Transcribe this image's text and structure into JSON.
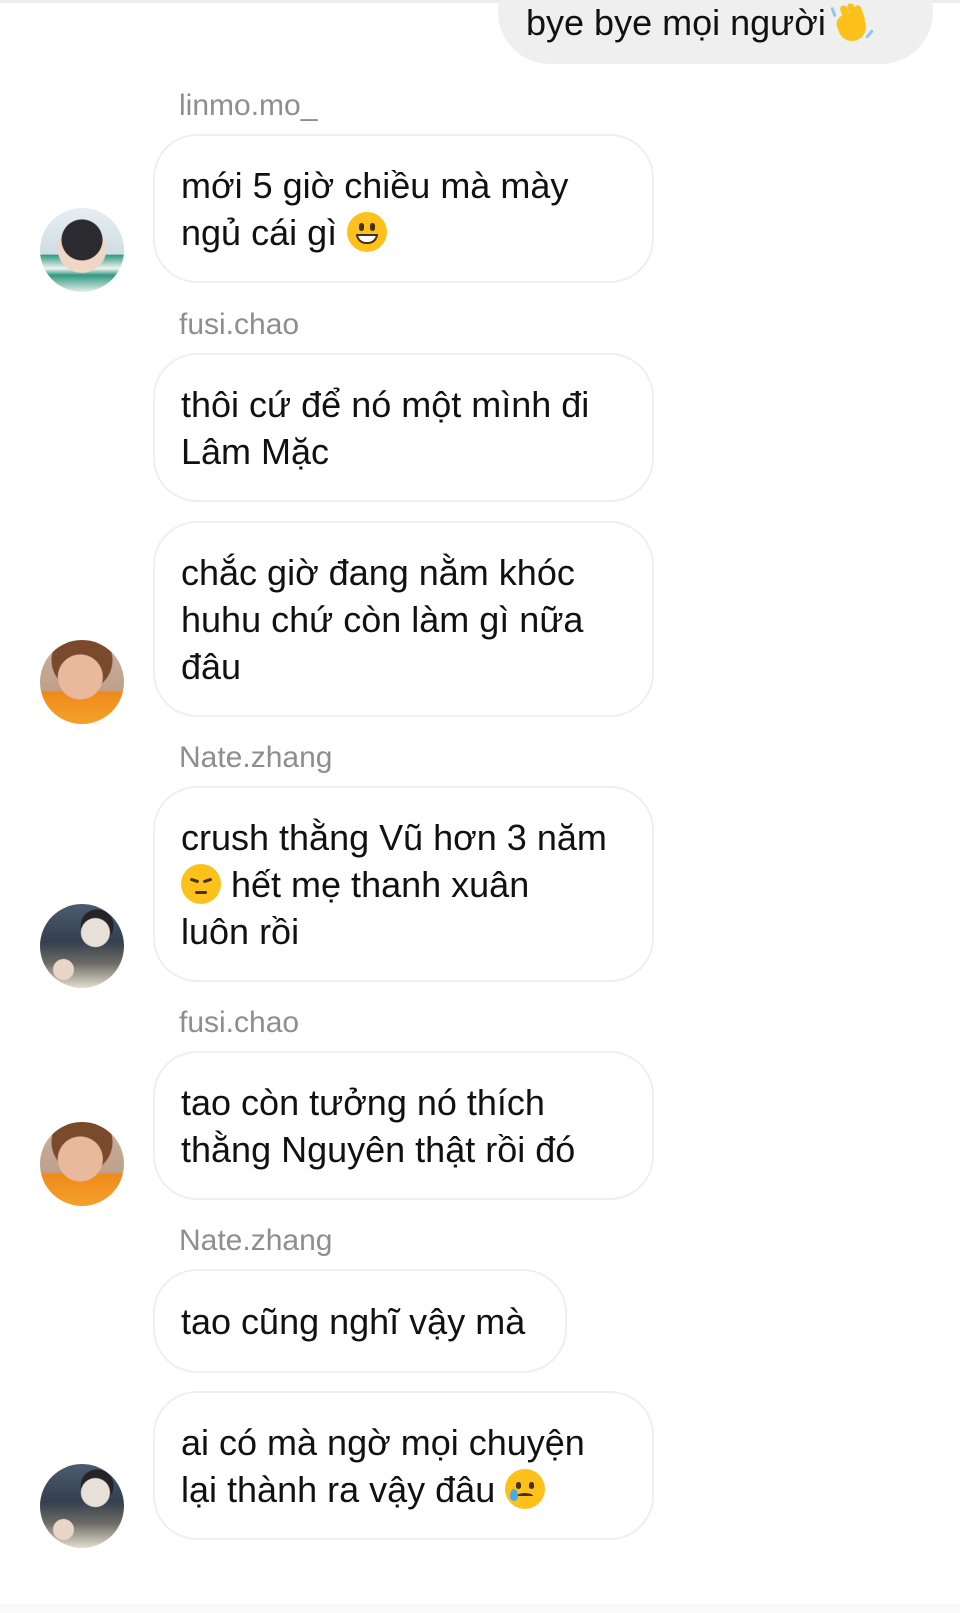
{
  "outgoing_message": {
    "text": "bye bye mọi người",
    "emoji": "waving-hand"
  },
  "messages": [
    {
      "sender": "linmo.mo_",
      "text": "mới 5 giờ chiều mà mày\nngủ cái gì",
      "emoji": "grinning-face",
      "avatar": "avatar-linmo"
    },
    {
      "sender": "fusi.chao",
      "text": "thôi cứ để nó một mình đi\nLâm Mặc",
      "emoji": "",
      "avatar": ""
    },
    {
      "sender": "",
      "text": "chắc giờ đang nằm khóc\nhuhu chứ còn làm gì nữa\nđâu",
      "emoji": "",
      "avatar": "avatar-fusi"
    },
    {
      "sender": "Nate.zhang",
      "text_1": "crush thằng Vũ hơn 3 năm",
      "text_2": " hết mẹ thanh xuân\nluôn rồi",
      "emoji": "pensive-face",
      "avatar": "avatar-nate"
    },
    {
      "sender": "fusi.chao",
      "text": "tao còn tưởng nó thích\nthằng Nguyên thật rồi đó",
      "emoji": "",
      "avatar": "avatar-fusi"
    },
    {
      "sender": "Nate.zhang",
      "text": "tao cũng nghĩ vậy mà",
      "emoji": "",
      "avatar": ""
    },
    {
      "sender": "",
      "text": "ai có mà ngờ mọi chuyện\nlại thành ra vậy đâu",
      "emoji": "smiling-face-with-tear",
      "avatar": "avatar-nate"
    }
  ],
  "colors": {
    "bubble_out": "#efefef",
    "bubble_border": "#efefef",
    "sender": "#8e8e8e",
    "text": "#111111"
  }
}
